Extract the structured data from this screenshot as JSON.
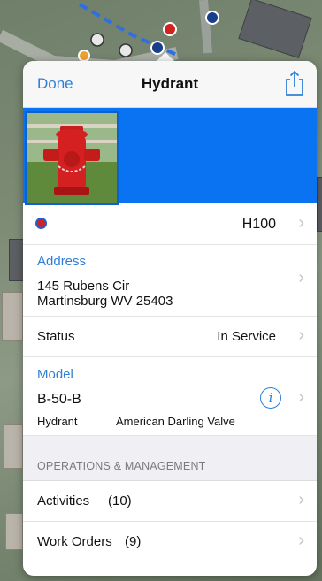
{
  "header": {
    "done_label": "Done",
    "title": "Hydrant",
    "share_icon": "share-icon"
  },
  "photo": {
    "icon": "hydrant-photo"
  },
  "asset_row": {
    "id": "H100",
    "icon": "hydrant-symbol-icon"
  },
  "address": {
    "label": "Address",
    "line1": "145 Rubens Cir",
    "line2": "Martinsburg WV 25403"
  },
  "status": {
    "label": "Status",
    "value": "In Service"
  },
  "model": {
    "label": "Model",
    "value": "B-50-B",
    "type": "Hydrant",
    "manufacturer": "American Darling Valve"
  },
  "section": {
    "title": "OPERATIONS & MANAGEMENT"
  },
  "activities": {
    "label": "Activities",
    "count": "(10)"
  },
  "work_orders": {
    "label": "Work Orders",
    "count": "(9)"
  },
  "colors": {
    "accent": "#2f7fd6",
    "photo_strip": "#0a73f2",
    "hydrant_red": "#d42020"
  }
}
